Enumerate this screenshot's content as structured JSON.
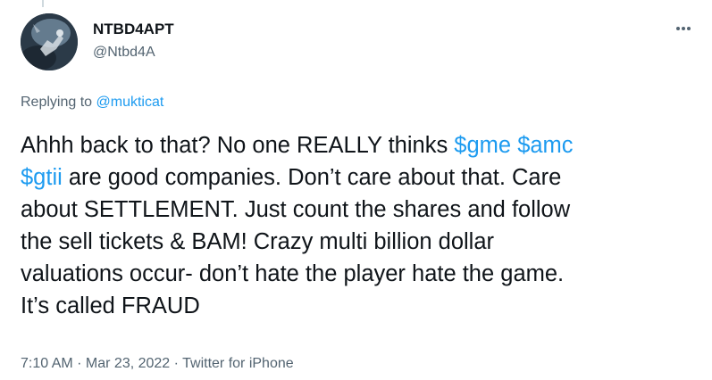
{
  "user": {
    "display_name": "NTBD4APT",
    "handle": "@Ntbd4A"
  },
  "reply": {
    "prefix": "Replying to",
    "mention": "@mukticat"
  },
  "tweet": {
    "line1_a": "Ahhh back to that? No one REALLY thinks ",
    "line1_tag1": "$gme",
    "line1_sp": " ",
    "line1_tag2": "$amc",
    "line2_tag": "$gtii",
    "line2_b": " are good companies. Don’t care about that. Care",
    "line3": "about SETTLEMENT. Just count the shares and follow",
    "line4": "the sell tickets & BAM! Crazy multi billion dollar",
    "line5": "valuations occur- don’t hate the player hate the game.",
    "line6": "It’s called FRAUD"
  },
  "meta": {
    "time": "7:10 AM",
    "sep1": " · ",
    "date": "Mar 23, 2022",
    "sep2": " · ",
    "source": "Twitter for iPhone"
  },
  "icons": {
    "more": "more-horizontal-icon"
  },
  "colors": {
    "link": "#1d9bf0",
    "text": "#0f1419",
    "secondary": "#536471"
  }
}
